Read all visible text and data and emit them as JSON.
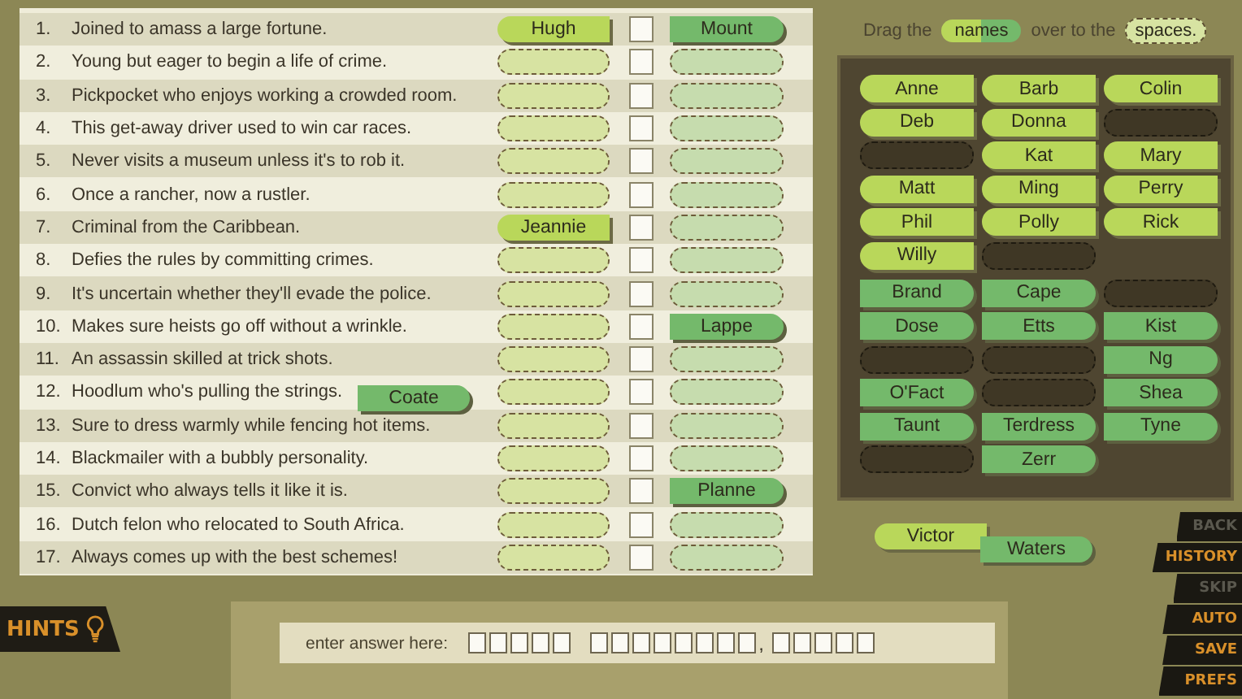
{
  "clues": [
    {
      "number": "1.",
      "text": "Joined to amass a large fortune.",
      "first": "Hugh",
      "last": "Mount",
      "checked": false
    },
    {
      "number": "2.",
      "text": "Young but eager to begin a life of crime.",
      "checked": false
    },
    {
      "number": "3.",
      "text": "Pickpocket who enjoys working a crowded room.",
      "checked": false
    },
    {
      "number": "4.",
      "text": "This get-away driver used to win car races.",
      "checked": false
    },
    {
      "number": "5.",
      "text": "Never visits a museum unless it's to rob it.",
      "checked": false
    },
    {
      "number": "6.",
      "text": "Once a rancher, now a rustler.",
      "checked": false
    },
    {
      "number": "7.",
      "text": "Criminal from the Caribbean.",
      "first": "Jeannie",
      "checked": false
    },
    {
      "number": "8.",
      "text": "Defies the rules by committing crimes.",
      "checked": false
    },
    {
      "number": "9.",
      "text": "It's uncertain whether they'll evade the police.",
      "checked": false
    },
    {
      "number": "10.",
      "text": "Makes sure heists go off without a wrinkle.",
      "last": "Lappe",
      "checked": false
    },
    {
      "number": "11.",
      "text": "An assassin skilled at trick shots.",
      "checked": false
    },
    {
      "number": "12.",
      "text": "Hoodlum who's pulling the strings.",
      "checked": false
    },
    {
      "number": "13.",
      "text": "Sure to dress warmly while fencing hot items.",
      "checked": false
    },
    {
      "number": "14.",
      "text": "Blackmailer with a bubbly personality.",
      "checked": false
    },
    {
      "number": "15.",
      "text": "Convict who always tells it like it is.",
      "last": "Planne",
      "checked": false
    },
    {
      "number": "16.",
      "text": "Dutch felon who relocated to South Africa.",
      "checked": false
    },
    {
      "number": "17.",
      "text": "Always comes up with the best schemes!",
      "checked": false
    }
  ],
  "instruction": [
    {
      "kind": "text",
      "text": "Drag the"
    },
    {
      "kind": "name_chip",
      "text": "names"
    },
    {
      "kind": "text",
      "text": "over to the"
    },
    {
      "kind": "space_chip",
      "text": "spaces."
    }
  ],
  "first_names": [
    {
      "kind": "tile",
      "name": "Anne"
    },
    {
      "kind": "tile",
      "name": "Barb"
    },
    {
      "kind": "tile",
      "name": "Colin"
    },
    {
      "kind": "tile",
      "name": "Deb"
    },
    {
      "kind": "tile",
      "name": "Donna"
    },
    {
      "kind": "empty"
    },
    {
      "kind": "empty"
    },
    {
      "kind": "tile",
      "name": "Kat"
    },
    {
      "kind": "tile",
      "name": "Mary"
    },
    {
      "kind": "tile",
      "name": "Matt"
    },
    {
      "kind": "tile",
      "name": "Ming"
    },
    {
      "kind": "tile",
      "name": "Perry"
    },
    {
      "kind": "tile",
      "name": "Phil"
    },
    {
      "kind": "tile",
      "name": "Polly"
    },
    {
      "kind": "tile",
      "name": "Rick"
    },
    {
      "kind": "tile",
      "name": "Willy"
    },
    {
      "kind": "empty"
    }
  ],
  "last_names": [
    {
      "kind": "tile",
      "name": "Brand"
    },
    {
      "kind": "tile",
      "name": "Cape"
    },
    {
      "kind": "empty"
    },
    {
      "kind": "tile",
      "name": "Dose"
    },
    {
      "kind": "tile",
      "name": "Etts"
    },
    {
      "kind": "tile",
      "name": "Kist"
    },
    {
      "kind": "empty"
    },
    {
      "kind": "empty"
    },
    {
      "kind": "tile",
      "name": "Ng"
    },
    {
      "kind": "tile",
      "name": "O'Fact"
    },
    {
      "kind": "empty"
    },
    {
      "kind": "tile",
      "name": "Shea"
    },
    {
      "kind": "tile",
      "name": "Taunt"
    },
    {
      "kind": "tile",
      "name": "Terdress"
    },
    {
      "kind": "tile",
      "name": "Tyne"
    },
    {
      "kind": "empty"
    },
    {
      "kind": "tile",
      "name": "Zerr"
    }
  ],
  "dragged": [
    {
      "kind": "last",
      "name": "Coate"
    },
    {
      "kind": "first",
      "name": "Victor"
    },
    {
      "kind": "last",
      "name": "Waters"
    }
  ],
  "menu": [
    {
      "label": "BACK",
      "disabled": true
    },
    {
      "label": "HISTORY",
      "disabled": false
    },
    {
      "label": "SKIP",
      "disabled": true
    },
    {
      "label": "AUTO",
      "disabled": false
    },
    {
      "label": "SAVE",
      "disabled": false
    },
    {
      "label": "PREFS",
      "disabled": false
    }
  ],
  "hints": {
    "label": "HINTS"
  },
  "answer": {
    "label": "enter answer here:",
    "cells": [
      {
        "kind": "box"
      },
      {
        "kind": "box"
      },
      {
        "kind": "box"
      },
      {
        "kind": "box"
      },
      {
        "kind": "box"
      },
      {
        "kind": "gap"
      },
      {
        "kind": "box"
      },
      {
        "kind": "box"
      },
      {
        "kind": "box"
      },
      {
        "kind": "box"
      },
      {
        "kind": "box"
      },
      {
        "kind": "box"
      },
      {
        "kind": "box"
      },
      {
        "kind": "box"
      },
      {
        "kind": "mark",
        "text": ","
      },
      {
        "kind": "box"
      },
      {
        "kind": "box"
      },
      {
        "kind": "box"
      },
      {
        "kind": "box"
      },
      {
        "kind": "box"
      }
    ]
  }
}
